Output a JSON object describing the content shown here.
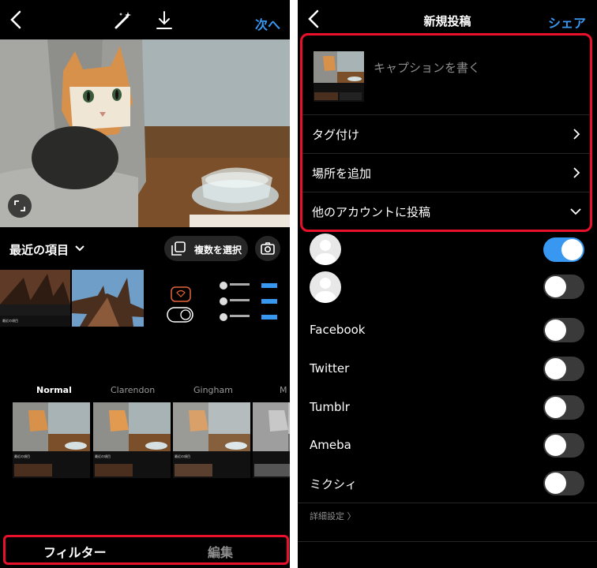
{
  "left": {
    "header": {
      "next_label": "次へ"
    },
    "gallery": {
      "recent_label": "最近の項目",
      "multi_select_label": "複数を選択",
      "thumb_caption": "最近の項目"
    },
    "filters": {
      "items": [
        "Normal",
        "Clarendon",
        "Gingham",
        "M"
      ],
      "selected": "Normal",
      "preview_caption": "最近の項目"
    },
    "tabs": {
      "filter_label": "フィルター",
      "edit_label": "編集"
    }
  },
  "right": {
    "header": {
      "title": "新規投稿",
      "share_label": "シェア"
    },
    "caption": {
      "placeholder": "キャプションを書く"
    },
    "rows": {
      "tag": "タグ付け",
      "location": "場所を追加",
      "other_accounts": "他のアカウントに投稿"
    },
    "accounts": [
      {
        "toggle_on": true
      },
      {
        "toggle_on": false
      }
    ],
    "share_targets": [
      {
        "label": "Facebook",
        "toggle_on": false
      },
      {
        "label": "Twitter",
        "toggle_on": false
      },
      {
        "label": "Tumblr",
        "toggle_on": false
      },
      {
        "label": "Ameba",
        "toggle_on": false
      },
      {
        "label": "ミクシィ",
        "toggle_on": false
      }
    ],
    "advanced_label": "詳細設定 〉"
  },
  "colors": {
    "accent": "#3897f0",
    "highlight_border": "#e8102a",
    "background": "#000000"
  }
}
